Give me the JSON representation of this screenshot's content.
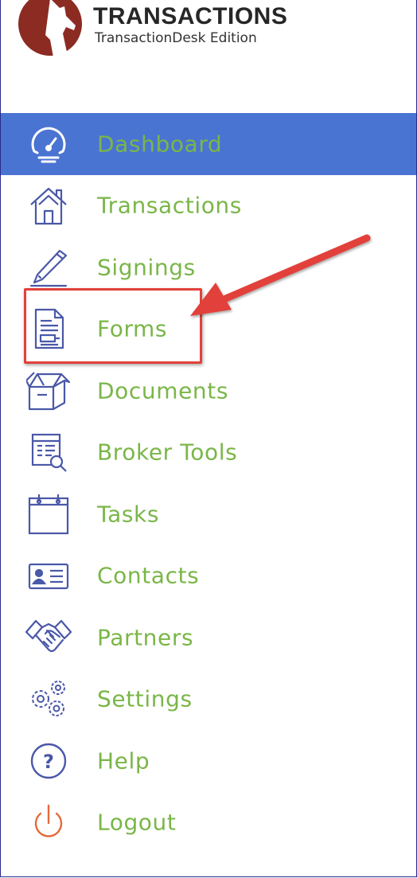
{
  "brand": {
    "title": "TRANSACTIONS",
    "subtitle": "TransactionDesk Edition",
    "logo_icon": "wolf-howl-logo",
    "logo_color": "#8b2b22"
  },
  "colors": {
    "active_bg": "#4a74d2",
    "label": "#7ab648",
    "icon_stroke": "#4a58a8",
    "annotation": "#e2403a"
  },
  "menu": {
    "items": [
      {
        "label": "Dashboard",
        "icon": "speedometer-icon",
        "active": true
      },
      {
        "label": "Transactions",
        "icon": "house-icon"
      },
      {
        "label": "Signings",
        "icon": "pen-icon"
      },
      {
        "label": "Forms",
        "icon": "form-document-icon"
      },
      {
        "label": "Documents",
        "icon": "open-box-icon"
      },
      {
        "label": "Broker Tools",
        "icon": "report-magnifier-icon"
      },
      {
        "label": "Tasks",
        "icon": "calendar-icon"
      },
      {
        "label": "Contacts",
        "icon": "contact-card-icon"
      },
      {
        "label": "Partners",
        "icon": "handshake-icon"
      },
      {
        "label": "Settings",
        "icon": "gears-icon"
      },
      {
        "label": "Help",
        "icon": "question-circle-icon"
      },
      {
        "label": "Logout",
        "icon": "power-icon"
      }
    ]
  },
  "annotation": {
    "highlighted_item": "Forms",
    "shape": "red-arrow-and-box"
  }
}
